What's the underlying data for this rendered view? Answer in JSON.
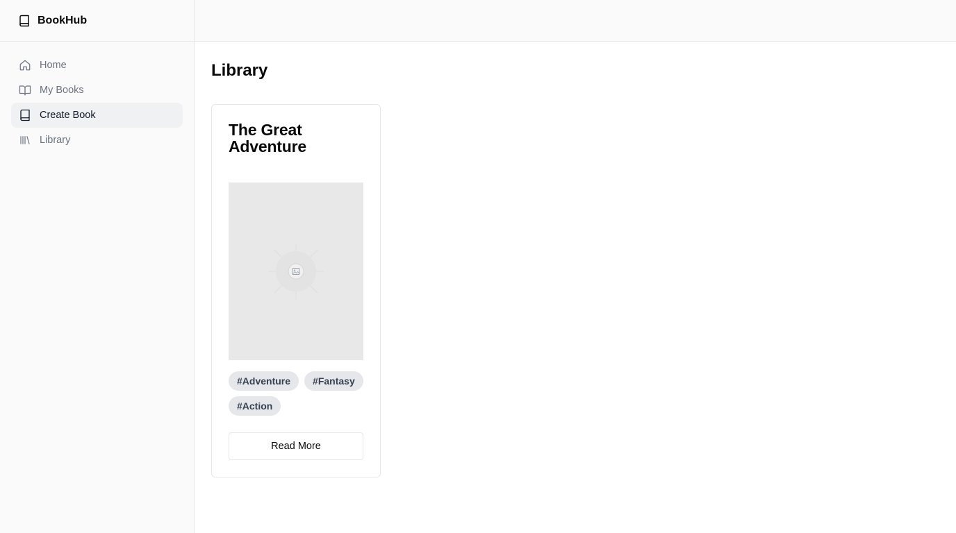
{
  "app": {
    "name": "BookHub",
    "logo_icon": "book-icon"
  },
  "sidebar": {
    "items": [
      {
        "label": "Home",
        "icon": "home-icon",
        "active": false
      },
      {
        "label": "My Books",
        "icon": "book-open-icon",
        "active": false
      },
      {
        "label": "Create Book",
        "icon": "book-icon",
        "active": true
      },
      {
        "label": "Library",
        "icon": "library-icon",
        "active": false
      }
    ]
  },
  "page": {
    "title": "Library"
  },
  "books": [
    {
      "title": "The Great Adventure",
      "cover_icon": "image-placeholder-icon",
      "tags": [
        "#Adventure",
        "#Fantasy",
        "#Action"
      ],
      "read_more_label": "Read More"
    }
  ],
  "colors": {
    "sidebar_bg": "#fafafa",
    "active_item_bg": "#f0f1f3",
    "tag_bg": "#e5e7eb",
    "border": "#e5e7eb",
    "muted_text": "#6b7280"
  }
}
